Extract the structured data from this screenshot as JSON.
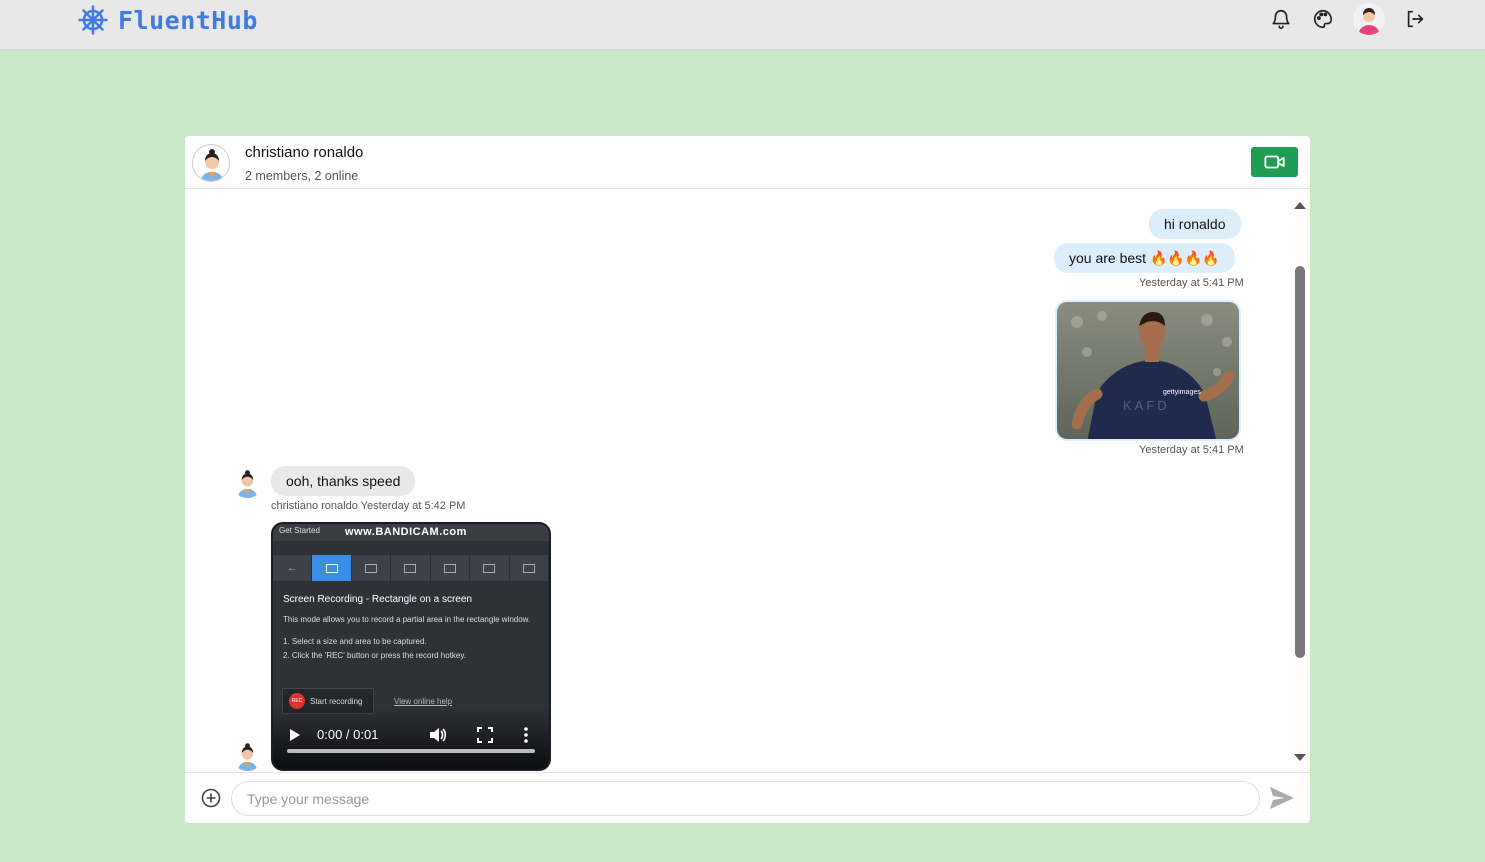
{
  "app": {
    "brand": "FluentHub"
  },
  "chat": {
    "name": "christiano ronaldo",
    "subtitle": "2 members, 2 online"
  },
  "messages": {
    "m1": "hi ronaldo",
    "m2": "you are best 🔥🔥🔥🔥",
    "m2_meta": "Yesterday at 5:41 PM",
    "img_meta": "Yesterday at 5:41 PM",
    "m3": "ooh, thanks speed",
    "m3_meta": "christiano ronaldo Yesterday at 5:42 PM"
  },
  "video": {
    "tab_label": "Get Started",
    "watermark": "www.BANDICAM.com",
    "title": "Screen Recording - Rectangle on a screen",
    "desc": "This mode allows you to record a partial area in the rectangle window.",
    "step1": "1. Select a size and area to be captured.",
    "step2": "2. Click the 'REC' button or press the record hotkey.",
    "rec_badge": "REC",
    "rec_label": "Start recording",
    "help_link": "View online help",
    "time": "0:00 / 0:01"
  },
  "image_credit": "gettyimages",
  "composer": {
    "placeholder": "Type your message"
  },
  "icons": {
    "brand": "ship-wheel-icon",
    "notifications": "bell-icon",
    "theme": "palette-icon",
    "logout": "logout-icon",
    "video_call": "video-camera-icon",
    "attach": "plus-circle-icon",
    "send": "send-icon"
  },
  "colors": {
    "background": "#c9e8c8",
    "brand": "#3f7be0",
    "video_button": "#1f9d55",
    "my_bubble": "#dcedfb",
    "their_bubble": "#e9e9e9"
  }
}
